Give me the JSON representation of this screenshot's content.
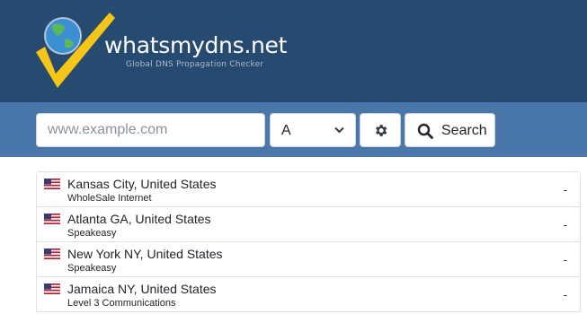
{
  "header": {
    "brand_name": "whatsmydns.net",
    "tagline": "Global DNS Propagation Checker",
    "colors": {
      "header_bg": "#274a70",
      "searchbar_bg": "#4a77a9",
      "logo_check": "#f5c518",
      "logo_globe": "#3d8fd1"
    }
  },
  "search": {
    "placeholder": "www.example.com",
    "value": "",
    "record_type": "A",
    "settings_icon": "gear-icon",
    "search_icon": "magnifier-icon",
    "search_label": "Search"
  },
  "results": [
    {
      "location": "Kansas City, United States",
      "provider": "WholeSale Internet",
      "result": "-",
      "flag": "us-flag-icon"
    },
    {
      "location": "Atlanta GA, United States",
      "provider": "Speakeasy",
      "result": "-",
      "flag": "us-flag-icon"
    },
    {
      "location": "New York NY, United States",
      "provider": "Speakeasy",
      "result": "-",
      "flag": "us-flag-icon"
    },
    {
      "location": "Jamaica NY, United States",
      "provider": "Level 3 Communications",
      "result": "-",
      "flag": "us-flag-icon"
    }
  ]
}
